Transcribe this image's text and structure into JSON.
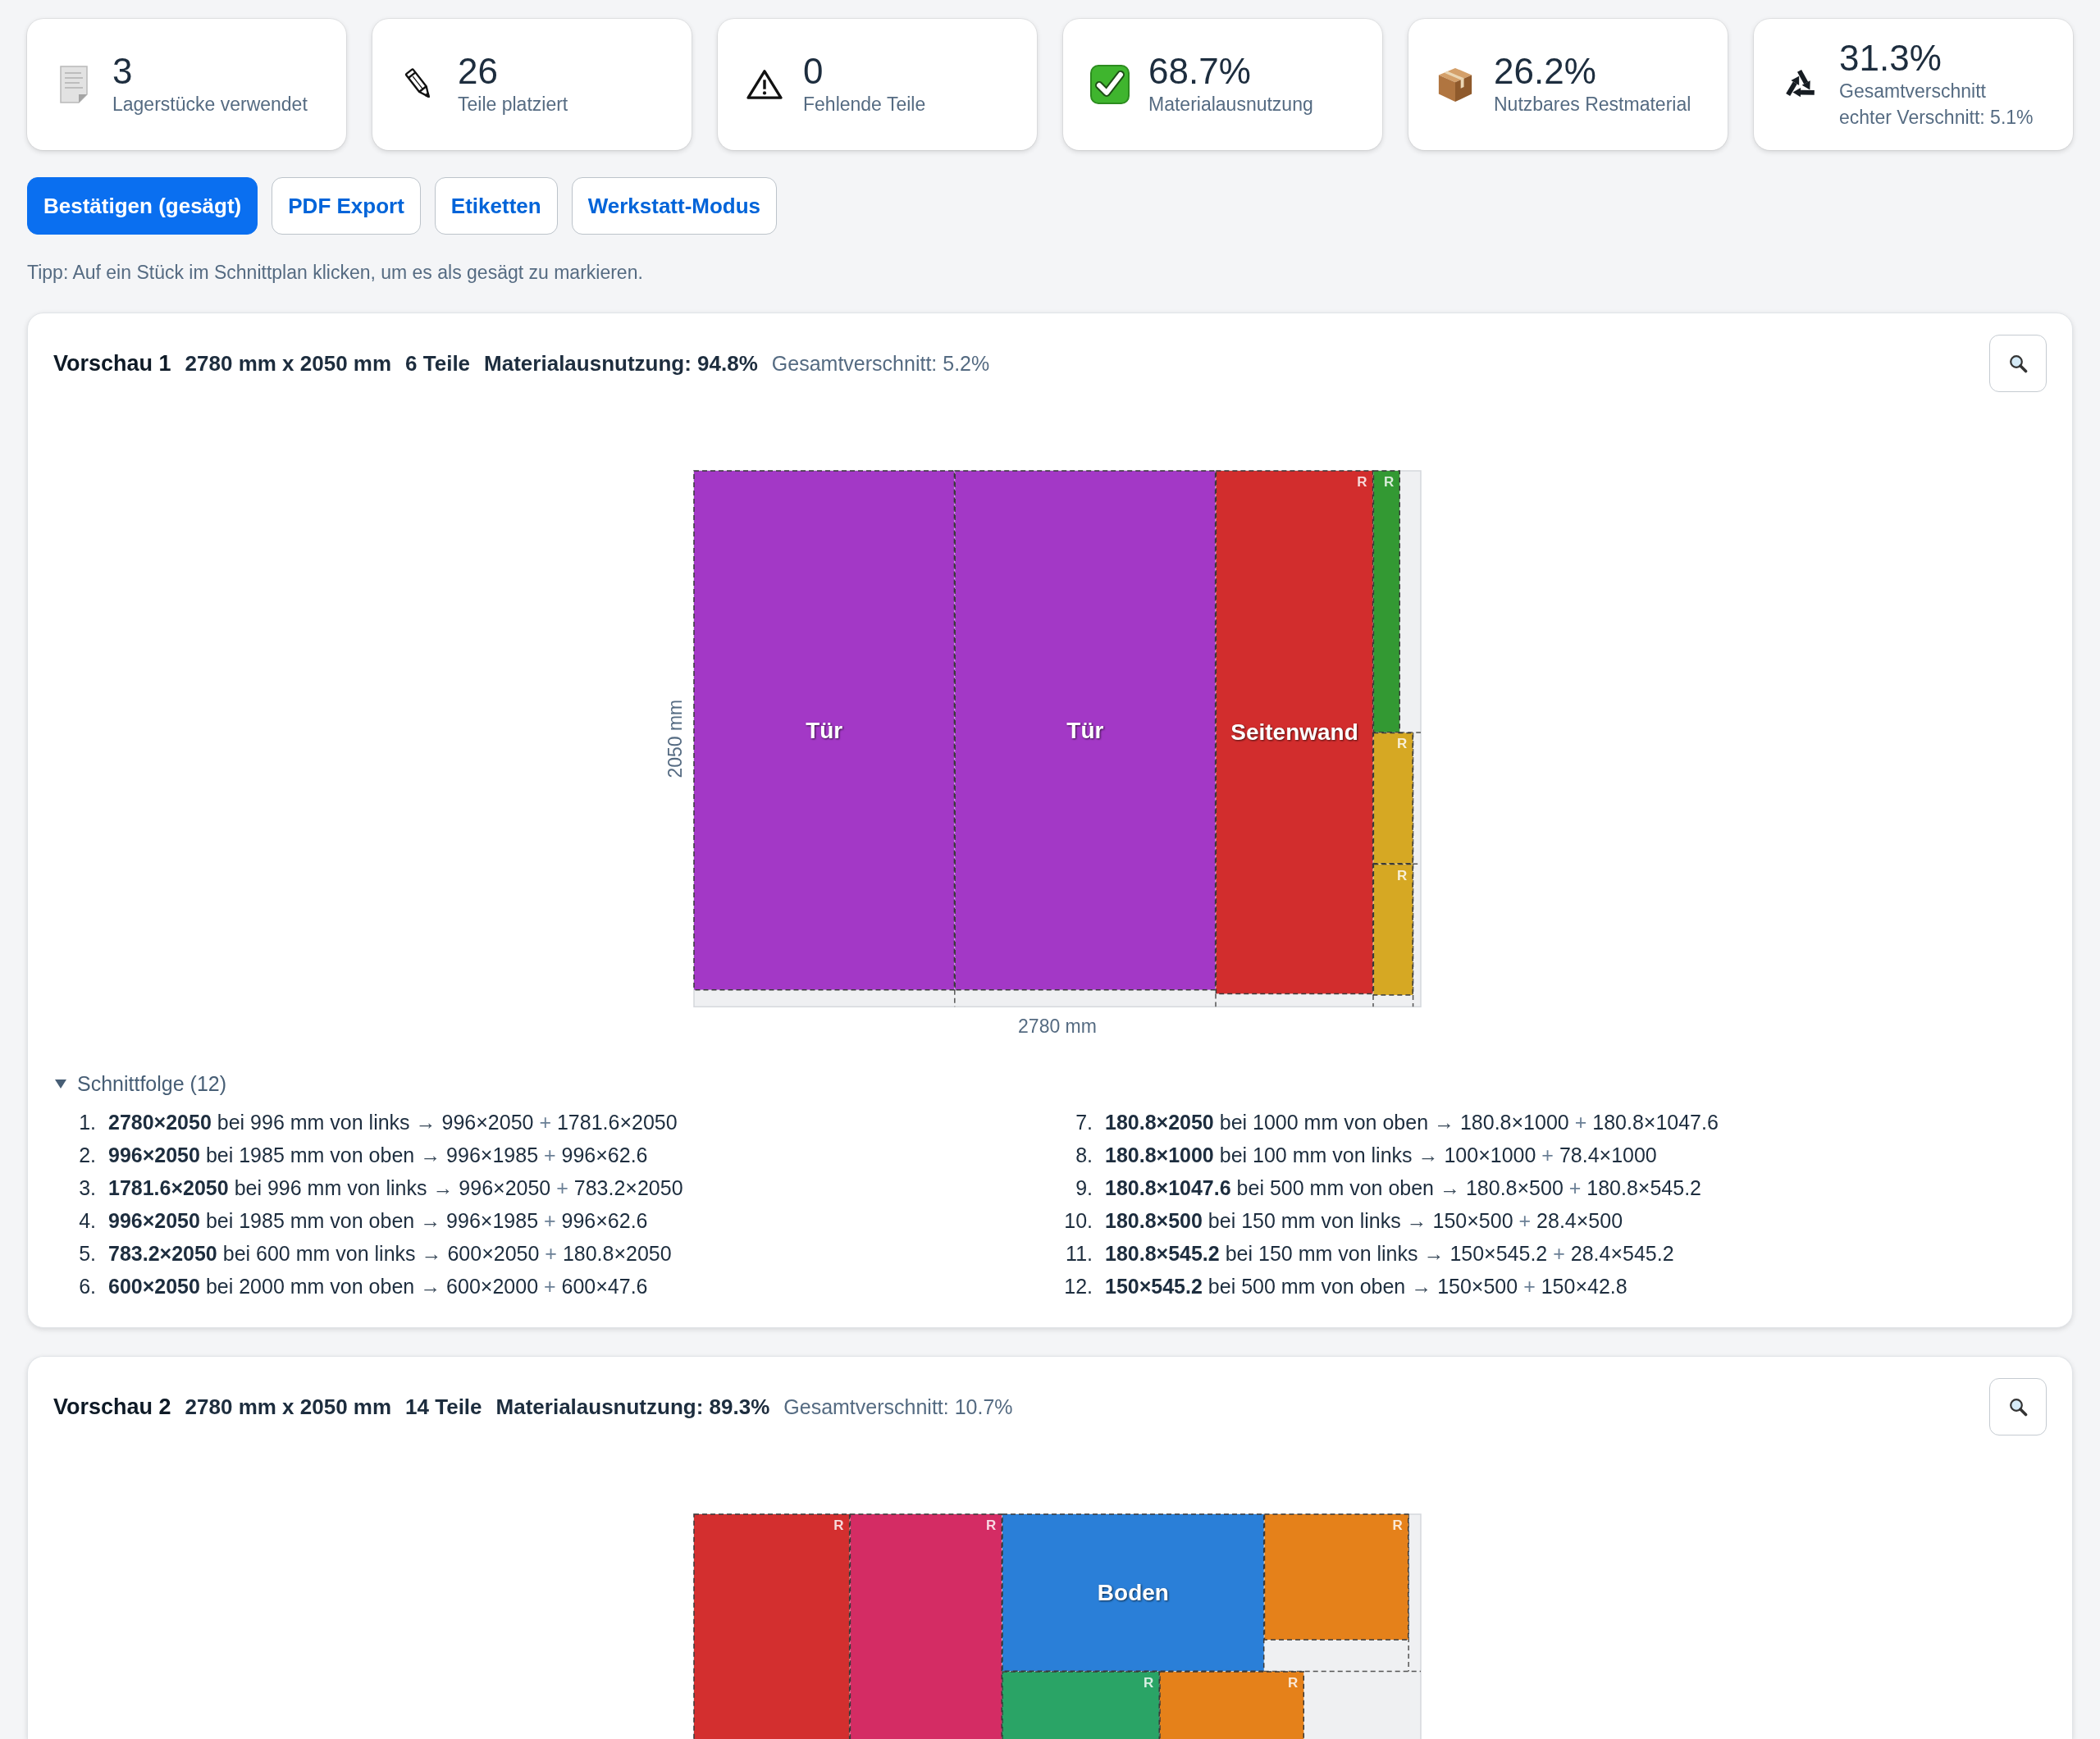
{
  "stats": [
    {
      "value": "3",
      "label": "Lagerstücke verwendet"
    },
    {
      "value": "26",
      "label": "Teile platziert"
    },
    {
      "value": "0",
      "label": "Fehlende Teile"
    },
    {
      "value": "68.7%",
      "label": "Materialausnutzung"
    },
    {
      "value": "26.2%",
      "label": "Nutzbares Restmaterial"
    },
    {
      "value": "31.3%",
      "label": "Gesamtverschnitt",
      "note": "echter Verschnitt: 5.1%"
    }
  ],
  "actions": [
    {
      "label": "Bestätigen (gesägt)",
      "kind": "primary"
    },
    {
      "label": "PDF Export",
      "kind": "secondary"
    },
    {
      "label": "Etiketten",
      "kind": "secondary"
    },
    {
      "label": "Werkstatt-Modus",
      "kind": "secondary"
    }
  ],
  "tip": "Tipp: Auf ein Stück im Schnittplan klicken, um es als gesägt zu markieren.",
  "previews": [
    {
      "title": "Vorschau 1",
      "size": "2780 mm x 2050 mm",
      "parts": "6 Teile",
      "utilization": "Materialausnutzung: 94.8%",
      "waste": "Gesamtverschnitt: 5.2%",
      "sheet": {
        "height_label": "2050 mm",
        "width_label": "2780 mm",
        "pieces": [
          {
            "label": "Tür",
            "color": "#a338c6"
          },
          {
            "label": "Tür",
            "color": "#a338c6"
          },
          {
            "label": "Seitenwand",
            "mark": "R",
            "color": "#d22d2d"
          },
          {
            "mark": "R",
            "color": "#339933"
          },
          {
            "mark": "R",
            "color": "#d6a823"
          },
          {
            "mark": "R",
            "color": "#d6a823"
          }
        ]
      },
      "sequence": {
        "title": "Schnittfolge (12)",
        "expanded": true,
        "steps": [
          {
            "number": "1.",
            "cut": "2780×2050",
            "where": "bei 996 mm von links",
            "arrow": "→",
            "first": "996×2050",
            "plus": "+",
            "second": "1781.6×2050"
          },
          {
            "number": "2.",
            "cut": "996×2050",
            "where": "bei 1985 mm von oben",
            "arrow": "→",
            "first": "996×1985",
            "plus": "+",
            "second": "996×62.6"
          },
          {
            "number": "3.",
            "cut": "1781.6×2050",
            "where": "bei 996 mm von links",
            "arrow": "→",
            "first": "996×2050",
            "plus": "+",
            "second": "783.2×2050"
          },
          {
            "number": "4.",
            "cut": "996×2050",
            "where": "bei 1985 mm von oben",
            "arrow": "→",
            "first": "996×1985",
            "plus": "+",
            "second": "996×62.6"
          },
          {
            "number": "5.",
            "cut": "783.2×2050",
            "where": "bei 600 mm von links",
            "arrow": "→",
            "first": "600×2050",
            "plus": "+",
            "second": "180.8×2050"
          },
          {
            "number": "6.",
            "cut": "600×2050",
            "where": "bei 2000 mm von oben",
            "arrow": "→",
            "first": "600×2000",
            "plus": "+",
            "second": "600×47.6"
          },
          {
            "number": "7.",
            "cut": "180.8×2050",
            "where": "bei 1000 mm von oben",
            "arrow": "→",
            "first": "180.8×1000",
            "plus": "+",
            "second": "180.8×1047.6"
          },
          {
            "number": "8.",
            "cut": "180.8×1000",
            "where": "bei 100 mm von links",
            "arrow": "→",
            "first": "100×1000",
            "plus": "+",
            "second": "78.4×1000"
          },
          {
            "number": "9.",
            "cut": "180.8×1047.6",
            "where": "bei 500 mm von oben",
            "arrow": "→",
            "first": "180.8×500",
            "plus": "+",
            "second": "180.8×545.2"
          },
          {
            "number": "10.",
            "cut": "180.8×500",
            "where": "bei 150 mm von links",
            "arrow": "→",
            "first": "150×500",
            "plus": "+",
            "second": "28.4×500"
          },
          {
            "number": "11.",
            "cut": "180.8×545.2",
            "where": "bei 150 mm von links",
            "arrow": "→",
            "first": "150×545.2",
            "plus": "+",
            "second": "28.4×545.2"
          },
          {
            "number": "12.",
            "cut": "150×545.2",
            "where": "bei 500 mm von oben",
            "arrow": "→",
            "first": "150×500",
            "plus": "+",
            "second": "150×42.8"
          }
        ]
      }
    },
    {
      "title": "Vorschau 2",
      "size": "2780 mm x 2050 mm",
      "parts": "14 Teile",
      "utilization": "Materialausnutzung: 89.3%",
      "waste": "Gesamtverschnitt: 10.7%",
      "sheet": {
        "pieces": [
          {
            "mark": "R",
            "color": "#d32f2f"
          },
          {
            "mark": "R",
            "color": "#d42c64"
          },
          {
            "label": "Boden",
            "color": "#2a7fd8"
          },
          {
            "mark": "R",
            "color": "#e5811a"
          },
          {
            "mark": "R",
            "color": "#2aa466"
          },
          {
            "mark": "R",
            "color": "#e5811a"
          }
        ]
      }
    }
  ]
}
